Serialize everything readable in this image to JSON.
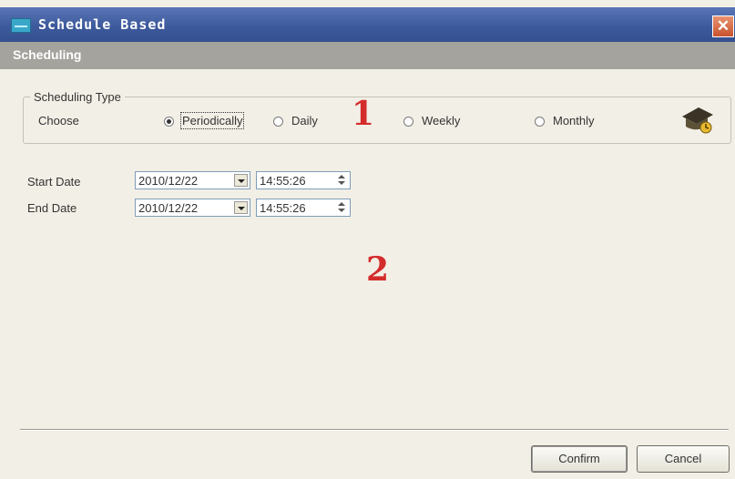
{
  "window": {
    "title": "Schedule Based",
    "close_symbol": "✕"
  },
  "section": {
    "title": "Scheduling"
  },
  "scheduling_type": {
    "legend": "Scheduling Type",
    "choose_label": "Choose",
    "options": [
      {
        "label": "Periodically",
        "selected": true
      },
      {
        "label": "Daily",
        "selected": false
      },
      {
        "label": "Weekly",
        "selected": false
      },
      {
        "label": "Monthly",
        "selected": false
      }
    ]
  },
  "dates": {
    "start_label": "Start Date",
    "start_date": "2010/12/22",
    "start_time": "14:55:26",
    "end_label": "End Date",
    "end_date": "2010/12/22",
    "end_time": "14:55:26"
  },
  "markers": {
    "one": "1",
    "two": "2"
  },
  "buttons": {
    "confirm": "Confirm",
    "cancel": "Cancel"
  },
  "icons": {
    "title": "window-app-icon",
    "corner": "scheduler-hat-icon",
    "close": "close-icon"
  },
  "colors": {
    "title_bar": "#3d5a9c",
    "section_bar": "#a5a39d",
    "background": "#f2efe6",
    "marker": "#d42b2b",
    "close_button": "#c8532f"
  }
}
